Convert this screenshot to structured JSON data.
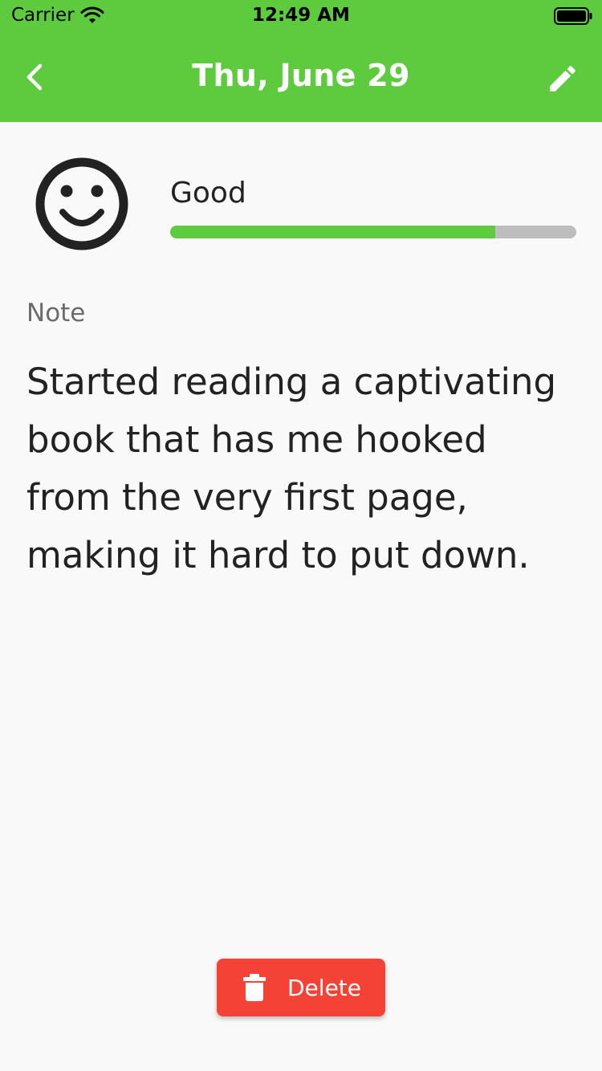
{
  "status_bar": {
    "carrier": "Carrier",
    "time": "12:49 AM",
    "wifi_icon": "wifi-icon",
    "battery_icon": "battery-icon"
  },
  "app_bar": {
    "title": "Thu, June 29",
    "back_icon": "chevron-left-icon",
    "edit_icon": "pencil-icon",
    "background_color": "#5ecb3f"
  },
  "mood": {
    "icon": "smiley-face-icon",
    "label": "Good",
    "level_fraction": 0.8,
    "fill_color": "#5ecb3f",
    "track_color": "#bdbdbd"
  },
  "note": {
    "label": "Note",
    "text": "Started reading a captivating book that has me hooked from the very first page, making it hard to put down."
  },
  "actions": {
    "delete_label": "Delete",
    "delete_icon": "trash-icon",
    "delete_color": "#f44336"
  }
}
